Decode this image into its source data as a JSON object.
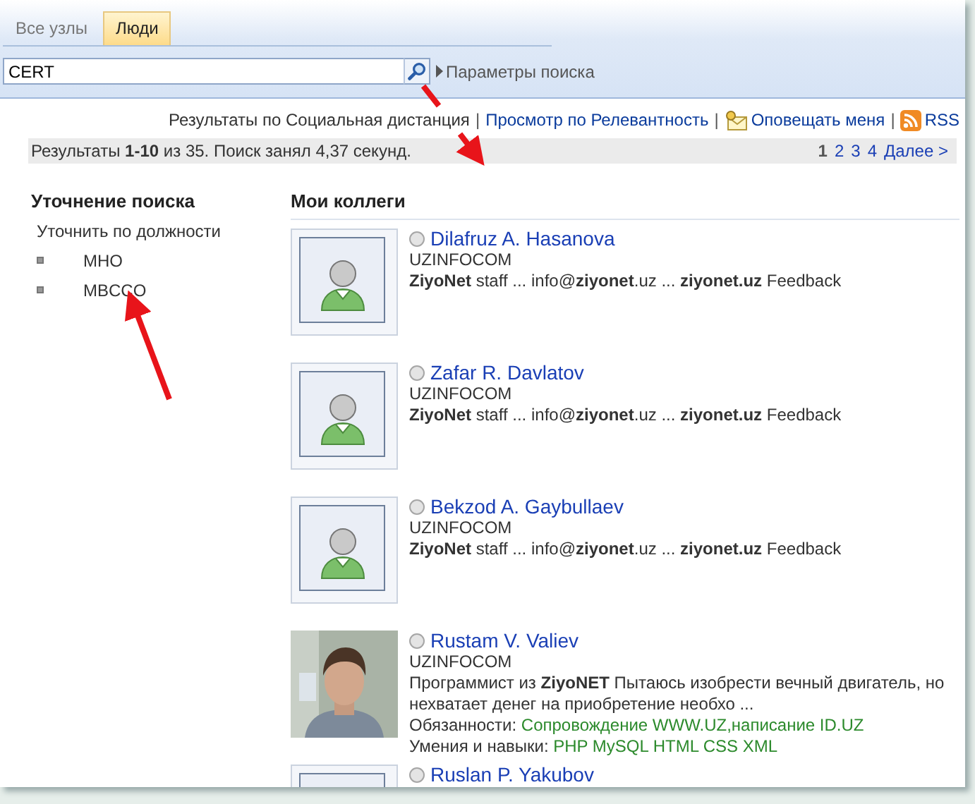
{
  "tabs": [
    {
      "label": "Все узлы",
      "selected": false
    },
    {
      "label": "Люди",
      "selected": true
    }
  ],
  "search": {
    "value": "CERT",
    "options_link": "Параметры поиска"
  },
  "toolbar": [
    {
      "kind": "text",
      "label": "Результаты по Социальная дистанция"
    },
    {
      "kind": "separator",
      "label": "|"
    },
    {
      "kind": "link",
      "label": "Просмотр по Релевантность"
    },
    {
      "kind": "separator",
      "label": "|"
    },
    {
      "kind": "alert",
      "label": "Оповещать меня"
    },
    {
      "kind": "separator",
      "label": "|"
    },
    {
      "kind": "rss",
      "label": "RSS"
    }
  ],
  "summary": "Результаты **1-10** из 35. Поиск занял 4,37 секунд.",
  "pager": [
    {
      "label": "1",
      "selected": true
    },
    {
      "label": "2",
      "selected": false
    },
    {
      "label": "3",
      "selected": false
    },
    {
      "label": "4",
      "selected": false
    },
    {
      "label": "Далее >",
      "selected": false
    }
  ],
  "refine": {
    "title": "Уточнение поиска",
    "group": "Уточнить по должности",
    "items": [
      "МНО",
      "MBCCO"
    ]
  },
  "results_title": "Мои коллеги",
  "people": [
    {
      "kind": "placeholder",
      "name": "Dilafruz A. Hasanova",
      "org": "UZINFOCOM",
      "description": "**ZiyoNet** staff ... info@**ziyonet**.uz ... **ziyonet.uz** Feedback"
    },
    {
      "kind": "placeholder",
      "name": "Zafar R. Davlatov",
      "org": "UZINFOCOM",
      "description": "**ZiyoNet** staff ... info@**ziyonet**.uz ... **ziyonet.uz** Feedback"
    },
    {
      "kind": "placeholder",
      "name": "Bekzod A. Gaybullaev",
      "org": "UZINFOCOM",
      "description": "**ZiyoNet** staff ... info@**ziyonet**.uz ... **ziyonet.uz** Feedback"
    },
    {
      "kind": "picture",
      "name": "Rustam V. Valiev",
      "org": "UZINFOCOM",
      "description": "Программист из **ZiyoNET** Пытаюсь изобрести вечный двигатель, но нехватает денег на приобретение необхо ...",
      "fields": [
        {
          "label": "Обязанности:",
          "value": "Сопровождение WWW.UZ,написание ID.UZ"
        },
        {
          "label": "Умения и навыки:",
          "value": "PHP MySQL HTML CSS XML"
        }
      ]
    },
    {
      "kind": "placeholder",
      "name": "Ruslan P. Yakubov"
    }
  ]
}
